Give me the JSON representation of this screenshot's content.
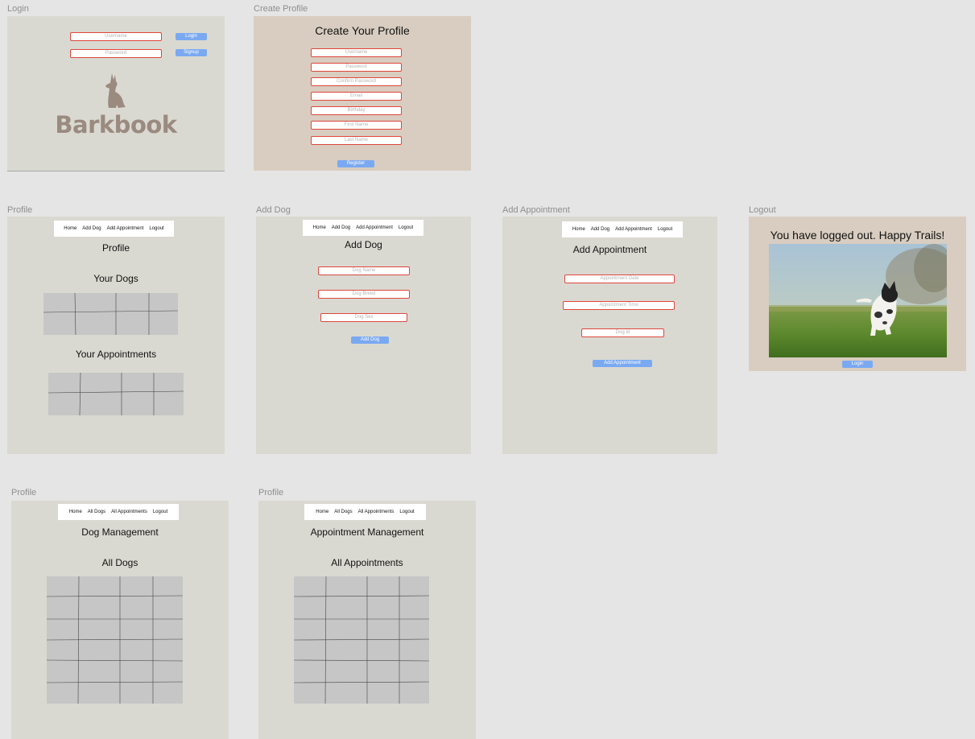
{
  "frames": {
    "login": {
      "label": "Login",
      "username_placeholder": "Username",
      "password_placeholder": "Password",
      "login_button": "Login",
      "signup_button": "Signup",
      "logo_text": "Barkbook"
    },
    "create_profile": {
      "label": "Create Profile",
      "title": "Create Your Profile",
      "fields": [
        "Username",
        "Password",
        "Confirm Password",
        "Email",
        "Birthday",
        "First Name",
        "Last Name"
      ],
      "register_button": "Register"
    },
    "profile": {
      "label": "Profile",
      "nav": [
        "Home",
        "Add Dog",
        "Add Appointment",
        "Logout"
      ],
      "title": "Profile",
      "dogs_heading": "Your Dogs",
      "appointments_heading": "Your Appointments"
    },
    "add_dog": {
      "label": "Add Dog",
      "nav": [
        "Home",
        "Add Dog",
        "Add Appointment",
        "Logout"
      ],
      "title": "Add Dog",
      "fields": [
        "Dog Name",
        "Dog Breed",
        "Dog Sex"
      ],
      "submit_button": "Add Dog"
    },
    "add_appointment": {
      "label": "Add Appointment",
      "nav": [
        "Home",
        "Add Dog",
        "Add Appointment",
        "Logout"
      ],
      "title": "Add Appointment",
      "fields": [
        "Appointment Date",
        "Appointment Time",
        "Dog Id"
      ],
      "submit_button": "Add Appointment"
    },
    "logout": {
      "label": "Logout",
      "message": "You have logged out. Happy Trails!",
      "login_button": "Login"
    },
    "dog_management": {
      "label": "Profile",
      "nav": [
        "Home",
        "All Dogs",
        "All Appointments",
        "Logout"
      ],
      "title": "Dog Management",
      "heading": "All Dogs"
    },
    "appointment_management": {
      "label": "Profile",
      "nav": [
        "Home",
        "All Dogs",
        "All Appointments",
        "Logout"
      ],
      "title": "Appointment Management",
      "heading": "All Appointments"
    }
  },
  "colors": {
    "canvas": "#e5e5e5",
    "frame_gray": "#dad9d1",
    "frame_tan": "#d8cdc0",
    "input_border": "#e0463c",
    "button": "#7aa9f2",
    "logo": "#9a8a80"
  }
}
